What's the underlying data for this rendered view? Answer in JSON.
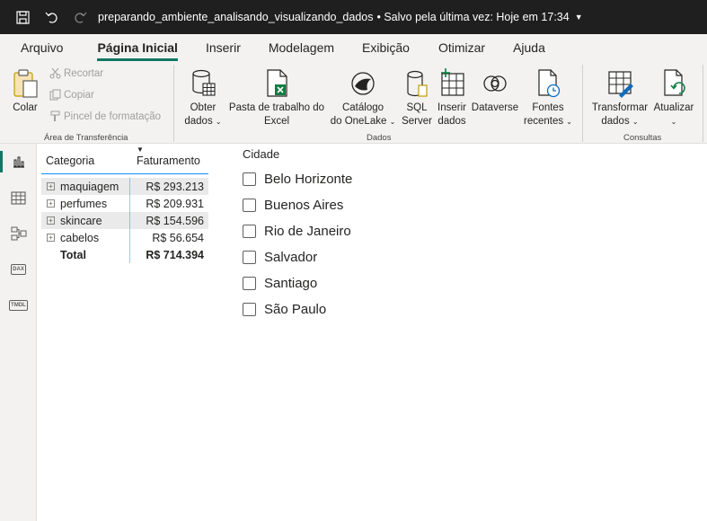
{
  "titlebar": {
    "file_name": "preparando_ambiente_analisando_visualizando_dados",
    "saved_status": "• Salvo pela última vez: Hoje em 17:34"
  },
  "menu": {
    "tabs": [
      "Arquivo",
      "Página Inicial",
      "Inserir",
      "Modelagem",
      "Exibição",
      "Otimizar",
      "Ajuda"
    ],
    "active_tab": "Página Inicial"
  },
  "ribbon": {
    "clipboard": {
      "paste": "Colar",
      "cut": "Recortar",
      "copy": "Copiar",
      "format_painter": "Pincel de formatação",
      "group_label": "Área de Transferência"
    },
    "data": {
      "get_data_line1": "Obter",
      "get_data_line2": "dados",
      "excel_line1": "Pasta de trabalho do",
      "excel_line2": "Excel",
      "onelake_line1": "Catálogo",
      "onelake_line2": "do OneLake",
      "sql_line1": "SQL",
      "sql_line2": "Server",
      "enter_line1": "Inserir",
      "enter_line2": "dados",
      "dataverse": "Dataverse",
      "recent_line1": "Fontes",
      "recent_line2": "recentes",
      "group_label": "Dados"
    },
    "queries": {
      "transform_line1": "Transformar",
      "transform_line2": "dados",
      "refresh": "Atualizar",
      "group_label": "Consultas"
    }
  },
  "matrix": {
    "headers": [
      "Categoria",
      "Faturamento"
    ],
    "rows": [
      {
        "category": "maquiagem",
        "value": "R$ 293.213"
      },
      {
        "category": "perfumes",
        "value": "R$ 209.931"
      },
      {
        "category": "skincare",
        "value": "R$ 154.596"
      },
      {
        "category": "cabelos",
        "value": "R$ 56.654"
      }
    ],
    "total_label": "Total",
    "total_value": "R$ 714.394"
  },
  "slicer": {
    "title": "Cidade",
    "items": [
      "Belo Horizonte",
      "Buenos Aires",
      "Rio de Janeiro",
      "Salvador",
      "Santiago",
      "São Paulo"
    ]
  },
  "left_rail": {
    "dax_label": "DAX",
    "tmdl_label": "TMDL"
  },
  "colors": {
    "accent": "#117865",
    "matrix_border": "#118dff",
    "excel_green": "#107c41"
  }
}
